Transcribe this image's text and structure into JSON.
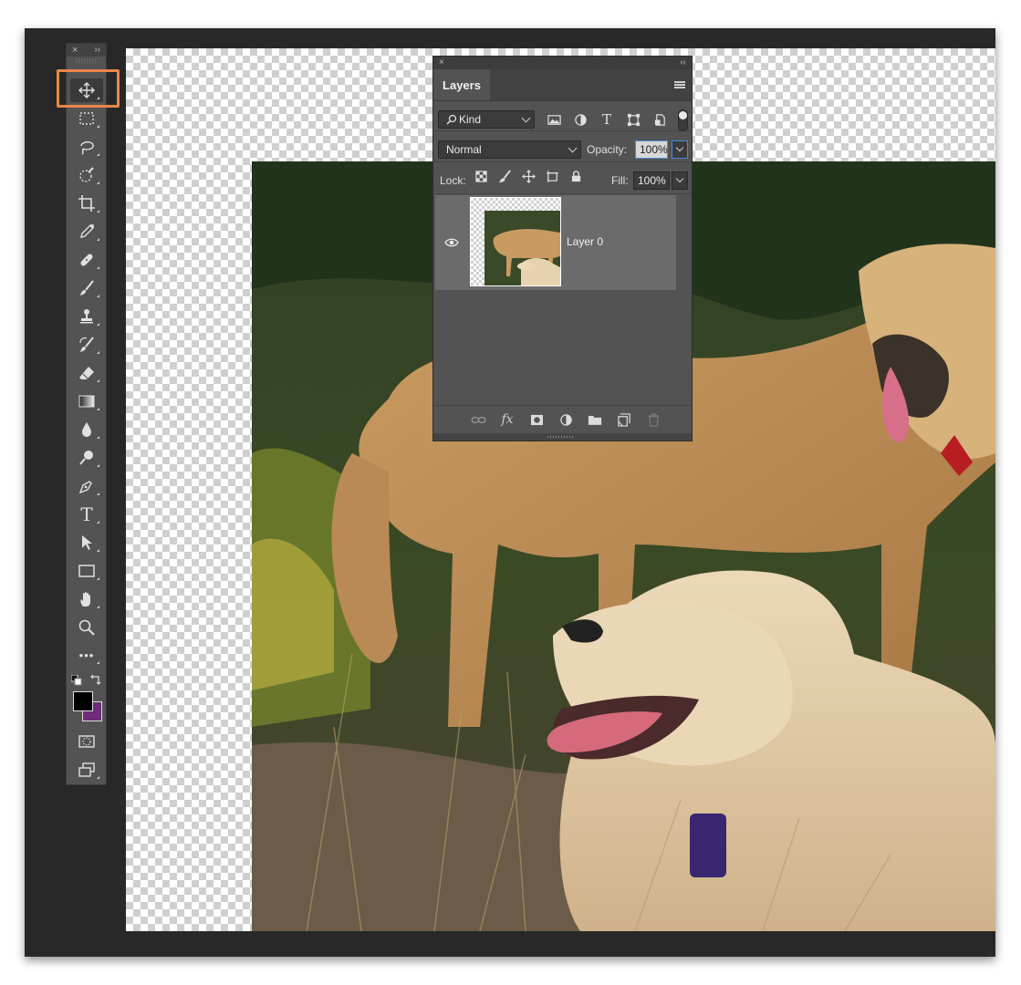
{
  "toolbar": {
    "close_glyph": "×",
    "collapse_glyph": "››",
    "tools": [
      {
        "name": "move-tool",
        "icon": "move-icon",
        "selected": true
      },
      {
        "name": "marquee-tool",
        "icon": "rect-marquee-icon"
      },
      {
        "name": "lasso-tool",
        "icon": "lasso-icon"
      },
      {
        "name": "quick-select-tool",
        "icon": "quick-select-icon"
      },
      {
        "name": "crop-tool",
        "icon": "crop-icon"
      },
      {
        "name": "eyedropper-tool",
        "icon": "eyedropper-icon"
      },
      {
        "name": "healing-brush-tool",
        "icon": "bandage-icon"
      },
      {
        "name": "brush-tool",
        "icon": "brush-icon"
      },
      {
        "name": "clone-stamp-tool",
        "icon": "stamp-icon"
      },
      {
        "name": "history-brush-tool",
        "icon": "history-brush-icon"
      },
      {
        "name": "eraser-tool",
        "icon": "eraser-icon"
      },
      {
        "name": "gradient-tool",
        "icon": "gradient-icon"
      },
      {
        "name": "blur-tool",
        "icon": "drop-icon"
      },
      {
        "name": "dodge-tool",
        "icon": "dodge-icon"
      },
      {
        "name": "pen-tool",
        "icon": "pen-icon"
      },
      {
        "name": "type-tool",
        "icon": "type-icon"
      },
      {
        "name": "path-select-tool",
        "icon": "arrow-icon"
      },
      {
        "name": "rectangle-tool",
        "icon": "rectangle-icon"
      },
      {
        "name": "hand-tool",
        "icon": "hand-icon"
      },
      {
        "name": "zoom-tool",
        "icon": "zoom-icon"
      },
      {
        "name": "more-tools",
        "icon": "ellipsis-icon"
      }
    ],
    "type_glyph": "T",
    "more_glyph": "•••",
    "foreground_color": "#000000",
    "background_color": "#6e2c7a"
  },
  "layers_panel": {
    "close_glyph": "×",
    "collapse_glyph": "‹‹",
    "tab_label": "Layers",
    "filter_label": "Kind",
    "blend_mode": "Normal",
    "opacity_label": "Opacity:",
    "opacity_value": "100%",
    "lock_label": "Lock:",
    "fill_label": "Fill:",
    "fill_value": "100%",
    "layers": [
      {
        "name": "Layer 0",
        "visible": true
      }
    ],
    "fx_label": "fx"
  },
  "colors": {
    "highlight": "#e8874a",
    "panel_bg": "#535353",
    "frame_bg": "#282828"
  }
}
